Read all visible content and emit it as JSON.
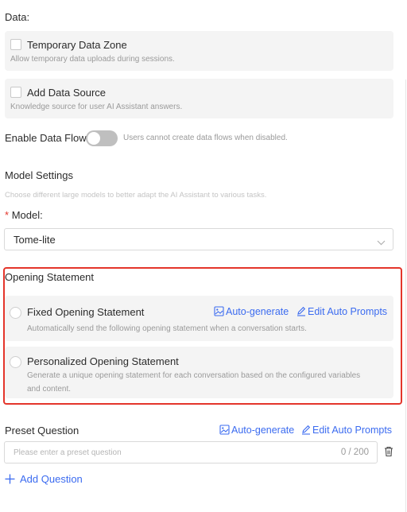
{
  "data_section": {
    "label": "Data:",
    "temp_zone": {
      "title": "Temporary Data Zone",
      "desc": "Allow temporary data uploads during sessions."
    },
    "data_source": {
      "title": "Add Data Source",
      "desc": "Knowledge source for user AI Assistant answers."
    },
    "data_flow": {
      "label": "Enable Data Flow",
      "hint": "Users cannot create data flows when disabled."
    }
  },
  "model_settings": {
    "title": "Model Settings",
    "desc": "Choose different large models to better adapt the AI Assistant to various tasks.",
    "required_mark": "*",
    "model_label": "Model:",
    "model_value": "Tome-lite"
  },
  "opening": {
    "title": "Opening Statement",
    "fixed": {
      "title": "Fixed Opening Statement",
      "desc": "Automatically send the following opening statement when a conversation starts."
    },
    "auto_generate": "Auto-generate",
    "edit_prompts": "Edit Auto Prompts",
    "personalized": {
      "title": "Personalized Opening Statement",
      "desc_line1": "Generate a unique opening statement for each conversation based on the configured variables",
      "desc_line2": "and content."
    }
  },
  "preset": {
    "title": "Preset Question",
    "auto_generate": "Auto-generate",
    "edit_prompts": "Edit Auto Prompts",
    "placeholder": "Please enter a preset question",
    "counter": "0 / 200",
    "add_label": "Add Question"
  },
  "colors": {
    "accent": "#3b6bf0",
    "highlight": "#e4352b",
    "card": "#f4f4f4"
  }
}
